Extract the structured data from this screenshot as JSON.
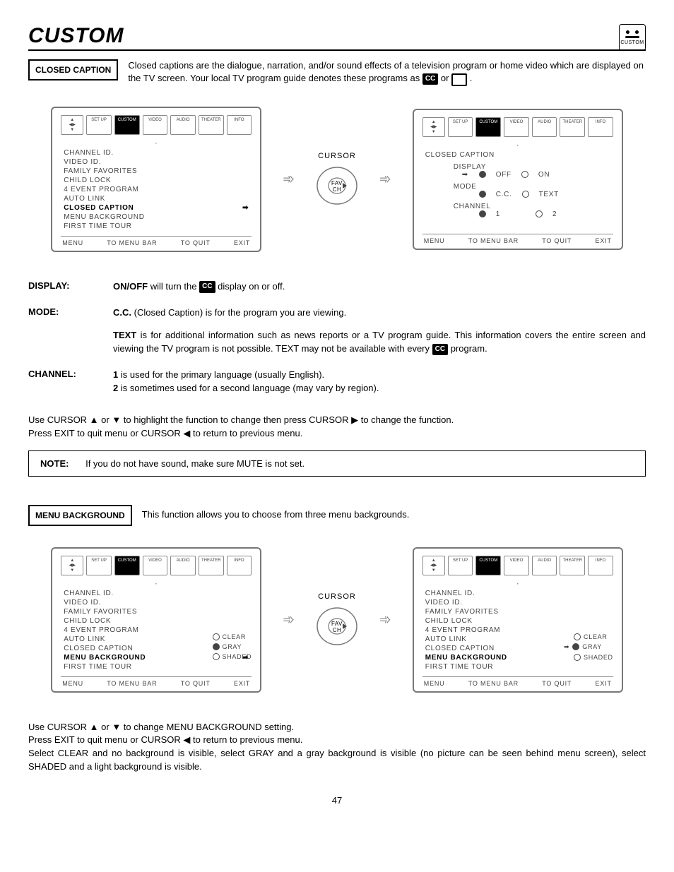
{
  "page_number": "47",
  "title": "CUSTOM",
  "badge_label": "CUSTOM",
  "section1": {
    "heading": "CLOSED CAPTION",
    "intro_a": "Closed captions are the dialogue, narration, and/or sound effects of a television program or home video which are displayed on the TV screen.  Your local TV program guide denotes these programs as ",
    "intro_or": " or ",
    "intro_end": " ."
  },
  "tabs": {
    "setup": "SET UP",
    "custom": "CUSTOM",
    "video": "VIDEO",
    "audio": "AUDIO",
    "theater": "THEATER",
    "info": "INFO"
  },
  "menu_items": {
    "channel_id": "CHANNEL ID.",
    "video_id": "VIDEO ID.",
    "family_fav": "FAMILY FAVORITES",
    "child_lock": "CHILD LOCK",
    "four_event": "4 EVENT PROGRAM",
    "auto_link": "AUTO LINK",
    "closed_caption": "CLOSED CAPTION",
    "menu_bg": "MENU BACKGROUND",
    "first_tour": "FIRST TIME TOUR"
  },
  "tv_footer": {
    "menu": "MENU",
    "to_menu_bar": "TO MENU BAR",
    "to_quit": "TO QUIT",
    "exit": "EXIT"
  },
  "cursor_label": "CURSOR",
  "cursor_fav": "FAV",
  "cursor_ch": "CH",
  "cc_screen": {
    "title": "CLOSED CAPTION",
    "display": "DISPLAY",
    "off": "OFF",
    "on": "ON",
    "mode": "MODE",
    "cc": "C.C.",
    "text": "TEXT",
    "channel": "CHANNEL",
    "one": "1",
    "two": "2"
  },
  "defs": {
    "display_label": "DISPLAY:",
    "display_lead": "ON/OFF",
    "display_a": " will turn the ",
    "display_b": " display on or off.",
    "mode_label": "MODE:",
    "mode_cc_lead": "C.C.",
    "mode_cc_rest": " (Closed Caption) is for the program you are viewing.",
    "mode_text_lead": "TEXT",
    "mode_text_rest_a": " is for additional information such as news reports or a TV program guide.  This information covers the entire screen and viewing the TV program is not possible.  TEXT may not be available with every ",
    "mode_text_rest_b": " program.",
    "channel_label": "CHANNEL:",
    "channel_1_lead": "1",
    "channel_1_rest": " is used for the primary language (usually English).",
    "channel_2_lead": "2",
    "channel_2_rest": " is sometimes used for a second language (may vary by region)."
  },
  "cc_instr_a": "Use CURSOR ▲ or ▼ to highlight the function to change then press CURSOR ▶ to change the function.",
  "cc_instr_b": "Press EXIT to quit menu or CURSOR ◀ to return to previous menu.",
  "note_label": "NOTE:",
  "note_text": "If you do not have sound, make sure MUTE is not set.",
  "section2": {
    "heading": "MENU BACKGROUND",
    "intro": "This function allows you to choose from three menu backgrounds."
  },
  "bg_opts": {
    "clear": "CLEAR",
    "gray": "GRAY",
    "shaded": "SHADED"
  },
  "bg_instr_a": "Use CURSOR ▲ or ▼ to change MENU BACKGROUND setting.",
  "bg_instr_b": "Press EXIT to quit menu or CURSOR ◀ to return to previous menu.",
  "bg_instr_c": "Select CLEAR and no background is visible, select GRAY and a gray background is visible (no picture can be seen behind menu screen), select SHADED and a light background is visible."
}
